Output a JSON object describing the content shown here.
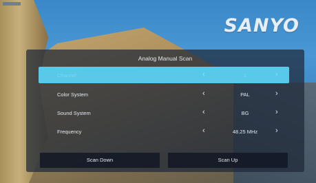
{
  "brand": {
    "logo_text": "SANYO"
  },
  "dialog": {
    "title": "Analog Manual Scan",
    "rows": [
      {
        "label": "Channel",
        "value": "1",
        "focused": true
      },
      {
        "label": "Color System",
        "value": "PAL",
        "focused": false
      },
      {
        "label": "Sound System",
        "value": "BG",
        "focused": false
      },
      {
        "label": "Frequency",
        "value": "48.25 MHz",
        "focused": false
      }
    ],
    "arrow_left": "‹",
    "arrow_right": "›",
    "buttons": {
      "scan_down": "Scan Down",
      "scan_up": "Scan Up"
    }
  },
  "colors": {
    "focus": "#59c9ea",
    "panel": "#1e2838"
  }
}
